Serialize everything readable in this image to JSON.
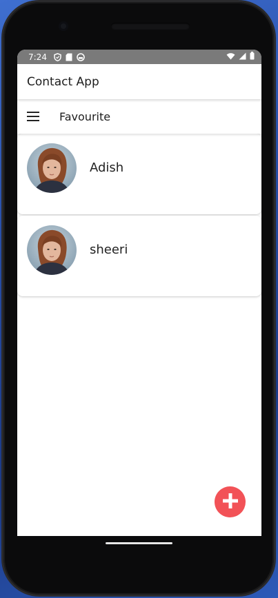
{
  "status_bar": {
    "time": "7:24",
    "icons": [
      "shield-icon",
      "sd-card-icon",
      "notification-icon"
    ],
    "right_icons": [
      "wifi-icon",
      "signal-icon",
      "battery-icon"
    ]
  },
  "app_bar": {
    "title": "Contact App"
  },
  "favourite_bar": {
    "menu_icon": "hamburger-menu-icon",
    "title": "Favourite"
  },
  "contacts": [
    {
      "name": "Adish",
      "avatar": "avatar-photo"
    },
    {
      "name": "sheeri",
      "avatar": "avatar-photo"
    }
  ],
  "fab": {
    "icon": "plus-icon",
    "color": "#f25257"
  },
  "colors": {
    "status_bar": "#7a7a7a",
    "fab": "#f25257",
    "screen_background": "#ffffff"
  }
}
